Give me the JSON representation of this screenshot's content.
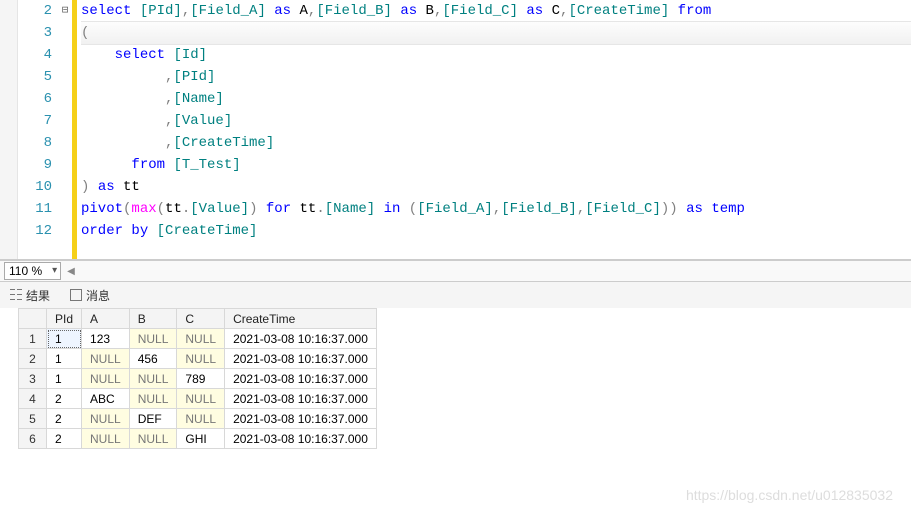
{
  "editor": {
    "lines": [
      {
        "n": 2,
        "fold": "⊟",
        "html": "<span class='kw'>select</span> <span class='br'>[PId]</span><span class='gr'>,</span><span class='br'>[Field_A]</span> <span class='kw'>as</span> A<span class='gr'>,</span><span class='br'>[Field_B]</span> <span class='kw'>as</span> B<span class='gr'>,</span><span class='br'>[Field_C]</span> <span class='kw'>as</span> C<span class='gr'>,</span><span class='br'>[CreateTime]</span> <span class='kw'>from</span>"
      },
      {
        "n": 3,
        "active": true,
        "html": "<span class='gr'>(</span>"
      },
      {
        "n": 4,
        "html": "    <span class='kw'>select</span> <span class='br'>[Id]</span>"
      },
      {
        "n": 5,
        "html": "          <span class='gr'>,</span><span class='br'>[PId]</span>"
      },
      {
        "n": 6,
        "html": "          <span class='gr'>,</span><span class='br'>[Name]</span>"
      },
      {
        "n": 7,
        "html": "          <span class='gr'>,</span><span class='br'>[Value]</span>"
      },
      {
        "n": 8,
        "html": "          <span class='gr'>,</span><span class='br'>[CreateTime]</span>"
      },
      {
        "n": 9,
        "html": "      <span class='kw'>from</span> <span class='br'>[T_Test]</span>"
      },
      {
        "n": 10,
        "html": "<span class='gr'>)</span> <span class='kw'>as</span> tt"
      },
      {
        "n": 11,
        "html": "<span class='kw'>pivot</span><span class='gr'>(</span><span class='fn'>max</span><span class='gr'>(</span>tt<span class='gr'>.</span><span class='br'>[Value]</span><span class='gr'>)</span> <span class='kw'>for</span> tt<span class='gr'>.</span><span class='br'>[Name]</span> <span class='kw'>in</span> <span class='gr'>(</span><span class='br'>[Field_A]</span><span class='gr'>,</span><span class='br'>[Field_B]</span><span class='gr'>,</span><span class='br'>[Field_C]</span><span class='gr'>))</span> <span class='kw'>as</span> <span class='kw'>temp</span>"
      },
      {
        "n": 12,
        "html": "<span class='kw'>order</span> <span class='kw'>by</span> <span class='br'>[CreateTime]</span>"
      }
    ]
  },
  "zoom": {
    "value": "110 %"
  },
  "tabs": {
    "results": "结果",
    "messages": "消息"
  },
  "grid": {
    "columns": [
      "PId",
      "A",
      "B",
      "C",
      "CreateTime"
    ],
    "null_label": "NULL",
    "rows": [
      {
        "PId": "1",
        "A": "123",
        "B": null,
        "C": null,
        "CreateTime": "2021-03-08 10:16:37.000"
      },
      {
        "PId": "1",
        "A": null,
        "B": "456",
        "C": null,
        "CreateTime": "2021-03-08 10:16:37.000"
      },
      {
        "PId": "1",
        "A": null,
        "B": null,
        "C": "789",
        "CreateTime": "2021-03-08 10:16:37.000"
      },
      {
        "PId": "2",
        "A": "ABC",
        "B": null,
        "C": null,
        "CreateTime": "2021-03-08 10:16:37.000"
      },
      {
        "PId": "2",
        "A": null,
        "B": "DEF",
        "C": null,
        "CreateTime": "2021-03-08 10:16:37.000"
      },
      {
        "PId": "2",
        "A": null,
        "B": null,
        "C": "GHI",
        "CreateTime": "2021-03-08 10:16:37.000"
      }
    ],
    "selected": {
      "row": 0,
      "col": "PId"
    }
  },
  "watermark": "https://blog.csdn.net/u012835032"
}
